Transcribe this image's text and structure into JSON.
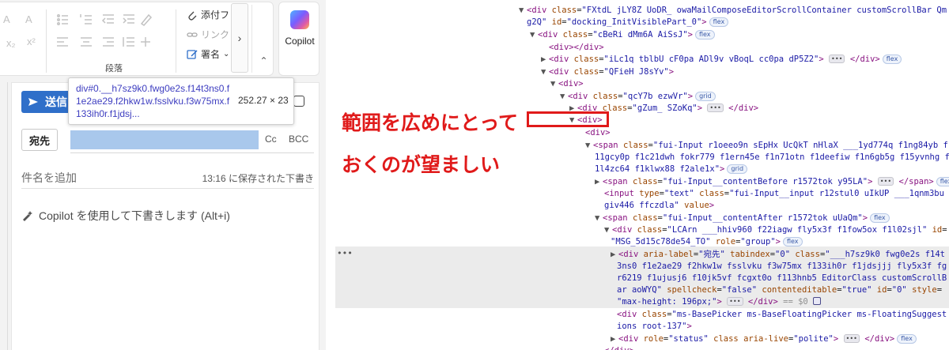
{
  "ribbon": {
    "paragraph_group_label": "段落",
    "attach_file_label": "添付フ",
    "link_label": "リンク",
    "signature_label": "署名",
    "signature_caret": "⌄",
    "scroll_right_glyph": "›",
    "collapse_glyph": "⌃",
    "copilot_label": "Copilot",
    "format_icons": [
      "A",
      "A",
      "x₂",
      "x²"
    ]
  },
  "compose": {
    "send_label": "送信",
    "to_label": "宛先",
    "cc_label": "Cc",
    "bcc_label": "BCC",
    "subject_placeholder": "件名を追加",
    "saved_status": "13:16 に保存された下書き",
    "copilot_draft": "Copilot を使用して下書きします (Alt+i)"
  },
  "tooltip": {
    "selector": "div#0.__h7sz9k0.fwg0e2s.f14t3ns0.f1e2ae29.f2hkw1w.fsslvku.f3w75mx.f133ih0r.f1jdsj...",
    "size": "252.27 × 23"
  },
  "annotation": {
    "line1": "範囲を広めにとって",
    "line2": "おくのが望ましい",
    "color": "#e01a1a"
  },
  "devtools": {
    "l0": "\"FXtdL jLY8Z UoDR_ owaMailComposeEditorScrollContainer customScrollBar Qm",
    "l0b": "g2Q\"",
    "l0id": "\"docking_InitVisiblePart_0\"",
    "l1": "\"cBeRi dMm6A AiSsJ\"",
    "l3": "\"iLc1q tblbU cF0pa ADl9v vBoqL cc0pa dP5Z2\"",
    "l4": "\"QFieH J8sYv\"",
    "l6": "\"qcY7b ezwVr\"",
    "l7": "\"gZum_ SZoKq\"",
    "l10a": "\"fui-Input r1oeeo9n sEpHx UcQkT nHlaX ___1yd774q f1ng84yb f",
    "l10b": "11gcy0p f1c21dwh fokr779 f1ern45e f1n71otn f1deefiw f1n6gb5g f15yvnhg f",
    "l10c": "1l4zc64 f1klwx88 f2ale1x\"",
    "l11": "\"fui-Input__contentBefore r1572tok y95LA\"",
    "l12a": "\"text\"",
    "l12b": "\"fui-Input__input r12stul0 uIkUP ___1qnm3bu f",
    "l12c": "giv446 ffczdla\"",
    "l12d": "value",
    "l13": "\"fui-Input__contentAfter r1572tok uUaQm\"",
    "l14a": "\"LCArn ___hhiv960 f22iagw fly5x3f f1fow5ox f1l02sjl\"",
    "l14b": "\"MSG_5d15c78de54_TO\"",
    "l14c": "\"group\"",
    "sel_label": "\"宛先\"",
    "sel_tab": "\"0\"",
    "sel_c1": "\"___h7sz9k0 fwg0e2s f14t",
    "sel_c2": "3ns0 f1e2ae29 f2hkw1w fsslvku f3w75mx f133ih0r f1jdsjjj fly5x3f fg",
    "sel_c3": "r6219 f1ujusj6 f10jk5vf fcgxt0o f113hnb5 EditorClass customScrollB",
    "sel_c4": "ar aoWYQ\"",
    "sel_spell": "\"false\"",
    "sel_ce": "\"true\"",
    "sel_id": "\"0\"",
    "sel_style_val": "\"max-height: 196px;\"",
    "sel_eq": "== $0",
    "bp1": "\"ms-BasePicker ms-BaseFloatingPicker ms-FloatingSuggest",
    "bp2": "ions root-137\"",
    "status_role": "\"status\"",
    "status_live": "\"polite\"",
    "flex_badge": "flex",
    "grid_badge": "grid",
    "ellipsis": "•••"
  }
}
